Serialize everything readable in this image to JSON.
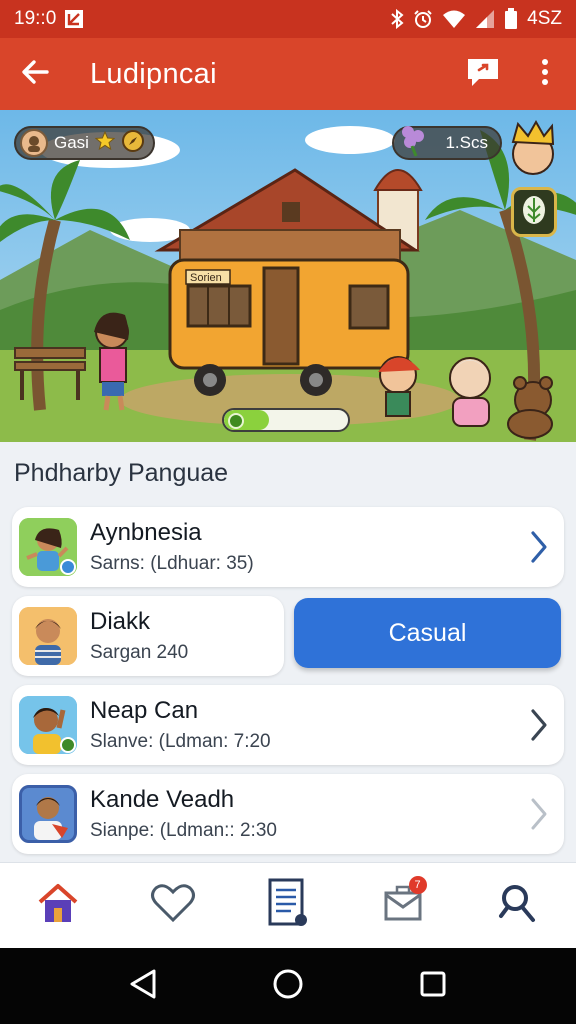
{
  "status_bar": {
    "time": "19::0",
    "battery_label": "4SZ",
    "icons": [
      "notification-icon",
      "bluetooth-icon",
      "alarm-icon",
      "wifi-icon",
      "signal-icon",
      "battery-icon"
    ]
  },
  "app_bar": {
    "title": "Ludipncai",
    "back_icon": "back-arrow-icon",
    "chat_icon": "chat-icon",
    "more_icon": "more-vert-icon"
  },
  "hero": {
    "player_name": "Gasi",
    "score_label": "1.Scs",
    "sign_text": "Sorien",
    "progress_fraction": 0.36
  },
  "section": {
    "title": "Phdharby Panguae"
  },
  "contacts": [
    {
      "name": "Aynbnesia",
      "subtitle": "Sarns: (Ldhuar: 35)"
    },
    {
      "name": "Diakk",
      "subtitle": "Sargan 240"
    },
    {
      "name": "Neap Can",
      "subtitle": "Slanve: (Ldman: 7:20"
    },
    {
      "name": "Kande Veadh",
      "subtitle": "Sianpe: (Ldman:: 2:30"
    }
  ],
  "casual_button": {
    "label": "Casual"
  },
  "bottom_nav": {
    "items": [
      "home-icon",
      "heart-icon",
      "document-icon",
      "inbox-icon",
      "search-icon"
    ],
    "inbox_badge": "7"
  },
  "colors": {
    "status_bar": "#c8331f",
    "app_bar": "#d9452a",
    "accent_blue": "#2f72d8",
    "progress_green": "#8bd13d"
  }
}
